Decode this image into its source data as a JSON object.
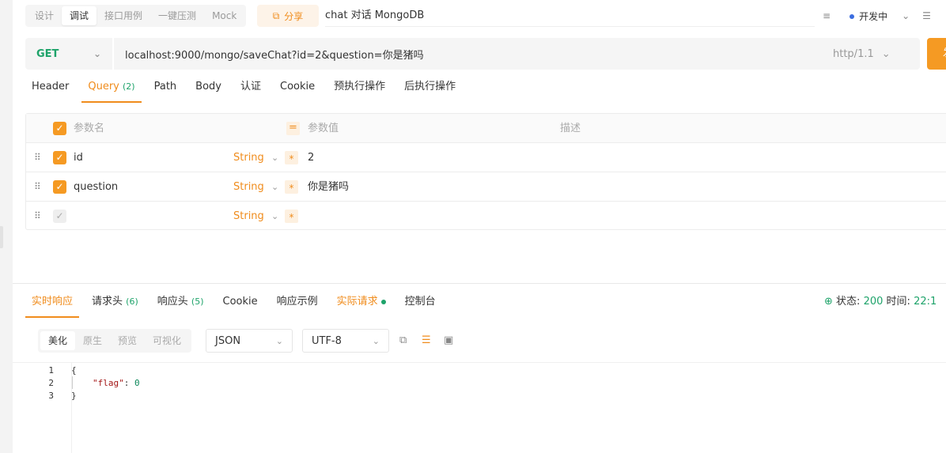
{
  "top_tabs": [
    "设计",
    "调试",
    "接口用例",
    "一键压测",
    "Mock"
  ],
  "share_label": "分享",
  "api_name": "chat 对话 MongoDB",
  "env_label": "开发中",
  "request": {
    "method": "GET",
    "url": "localhost:9000/mongo/saveChat?id=2&question=你是猪吗",
    "http_version": "http/1.1",
    "send_label": "发"
  },
  "param_tabs": {
    "header": "Header",
    "query": "Query",
    "query_count": "(2)",
    "path": "Path",
    "body": "Body",
    "auth": "认证",
    "cookie": "Cookie",
    "pre": "预执行操作",
    "post": "后执行操作"
  },
  "params_table": {
    "col_name": "参数名",
    "col_value": "参数值",
    "col_desc": "描述",
    "rows": [
      {
        "name": "id",
        "type": "String",
        "value": "2",
        "checked": true
      },
      {
        "name": "question",
        "type": "String",
        "value": "你是猪吗",
        "checked": true
      },
      {
        "name": "",
        "type": "String",
        "value": "",
        "checked": false
      }
    ]
  },
  "response_tabs": {
    "realtime": "实时响应",
    "req_headers": "请求头",
    "req_headers_count": "(6)",
    "resp_headers": "响应头",
    "resp_headers_count": "(5)",
    "cookie": "Cookie",
    "example": "响应示例",
    "actual": "实际请求",
    "console": "控制台"
  },
  "status": {
    "label": "状态:",
    "code": "200",
    "time_label": "时间:",
    "time": "22:1"
  },
  "format_tabs": [
    "美化",
    "原生",
    "预览",
    "可视化"
  ],
  "format_select": "JSON",
  "encoding_select": "UTF-8",
  "code": {
    "line_numbers": [
      "1",
      "2",
      "3"
    ],
    "open": "{",
    "key": "\"flag\"",
    "sep": ": ",
    "value": "0",
    "close": "}"
  },
  "colors": {
    "accent": "#f08c1c",
    "method_get": "#1ea36a",
    "status_ok": "#1ea36a"
  }
}
